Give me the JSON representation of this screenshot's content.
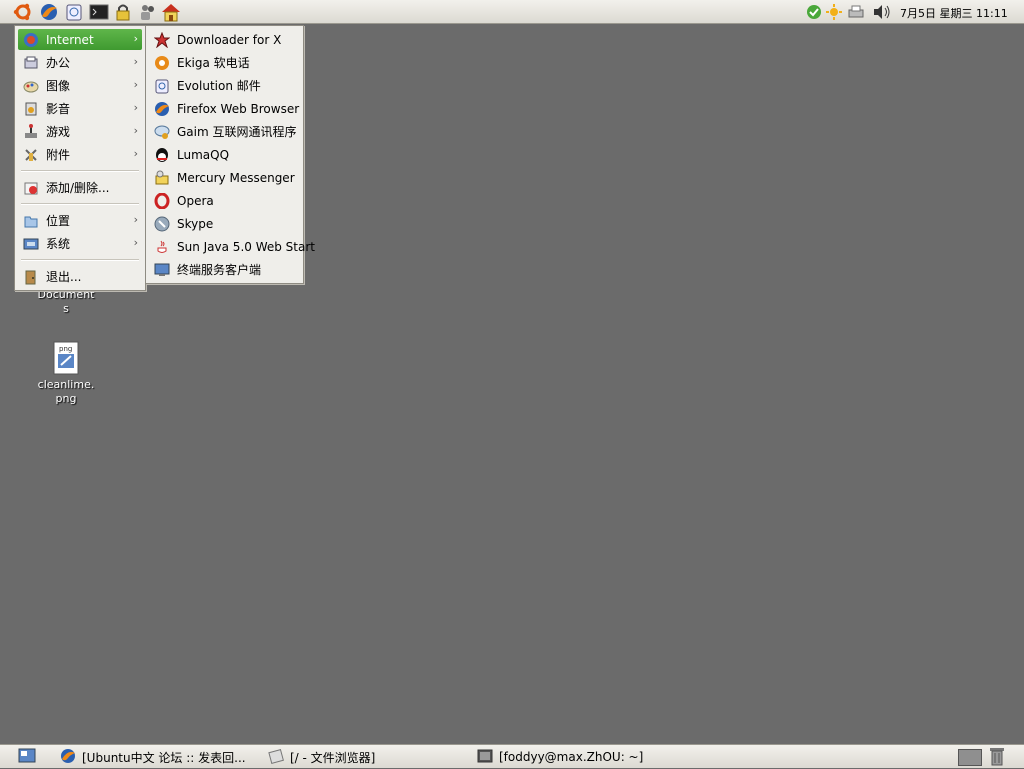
{
  "top_panel": {
    "launchers": [
      "ubuntu-logo-icon",
      "firefox-icon",
      "evolution-mail-icon",
      "terminal-icon",
      "lock-icon",
      "people-icon",
      "home-icon"
    ],
    "tray_icons": [
      "update-check-icon",
      "sun-update-icon",
      "printer-icon",
      "volume-icon"
    ],
    "clock": "7月5日 星期三 11:11"
  },
  "main_menu": {
    "items": [
      {
        "label": "Internet",
        "icon": "globe-icon",
        "submenu": true
      },
      {
        "label": "办公",
        "icon": "office-icon",
        "submenu": true
      },
      {
        "label": "图像",
        "icon": "graphics-icon",
        "submenu": true
      },
      {
        "label": "影音",
        "icon": "multimedia-icon",
        "submenu": true
      },
      {
        "label": "游戏",
        "icon": "games-icon",
        "submenu": true
      },
      {
        "label": "附件",
        "icon": "accessories-icon",
        "submenu": true
      },
      {
        "label": "添加/删除...",
        "icon": "add-remove-icon",
        "submenu": false
      },
      {
        "label": "位置",
        "icon": "places-icon",
        "submenu": true
      },
      {
        "label": "系统",
        "icon": "system-icon",
        "submenu": true
      },
      {
        "label": "退出...",
        "icon": "logout-icon",
        "submenu": false
      }
    ]
  },
  "internet_submenu": {
    "items": [
      {
        "label": "Downloader for X",
        "icon": "downloader-icon"
      },
      {
        "label": "Ekiga 软电话",
        "icon": "ekiga-icon"
      },
      {
        "label": "Evolution 邮件",
        "icon": "evolution-icon"
      },
      {
        "label": "Firefox Web Browser",
        "icon": "firefox-icon"
      },
      {
        "label": "Gaim 互联网通讯程序",
        "icon": "gaim-icon"
      },
      {
        "label": "LumaQQ",
        "icon": "lumaqq-icon"
      },
      {
        "label": "Mercury Messenger",
        "icon": "mercury-icon"
      },
      {
        "label": "Opera",
        "icon": "opera-icon"
      },
      {
        "label": "Skype",
        "icon": "skype-icon"
      },
      {
        "label": "Sun Java 5.0 Web Start",
        "icon": "java-icon"
      },
      {
        "label": "终端服务客户端",
        "icon": "terminal-server-icon"
      }
    ]
  },
  "desktop": {
    "icons": [
      {
        "label_line1": "Document",
        "label_line2": "s",
        "icon": "folder-icon"
      },
      {
        "label_line1": "cleanlime.",
        "label_line2": "png",
        "icon": "image-file-icon"
      }
    ]
  },
  "taskbar": {
    "show_desktop_icon": "show-desktop-icon",
    "tasks": [
      {
        "label": "[Ubuntu中文 论坛 :: 发表回...",
        "icon": "firefox-icon"
      },
      {
        "label": "[/ - 文件浏览器]",
        "icon": "file-browser-icon"
      },
      {
        "label": "[foddyy@max.ZhOU: ~]",
        "icon": "terminal-icon"
      }
    ],
    "trash_icon": "trash-icon"
  }
}
